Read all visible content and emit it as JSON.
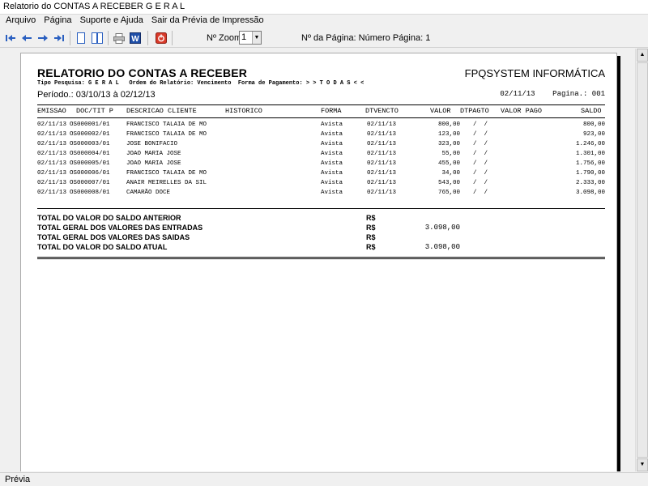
{
  "window": {
    "title": "Relatorio do CONTAS A RECEBER G E R A L"
  },
  "menu": [
    "Arquivo",
    "Página",
    "Suporte e Ajuda",
    "Sair da Prévia de Impressão"
  ],
  "toolbar": {
    "first_icon": "first-page-icon",
    "prev_icon": "prev-page-icon",
    "next_icon": "next-page-icon",
    "last_icon": "last-page-icon",
    "zoom_label": "Nº Zoom",
    "zoom_value": "1",
    "page_label": "Nº da Página: Número Página: 1"
  },
  "report": {
    "title": "RELATORIO DO CONTAS A RECEBER",
    "company": "FPQSYSTEM INFORMÁTICA",
    "subline": "Tipo Pesquisa: G E R A L   Ordem do Relatório: Vencimento  Forma de Pagamento: > > T O D A S < <",
    "periodo": "Período.: 03/10/13 à 02/12/13",
    "date_page": "02/11/13    Pagina.: 001",
    "columns": {
      "emissao": "EMISSAO",
      "doc": "DOC/TIT P",
      "descricao": "DESCRICAO CLIENTE",
      "historico": "HISTORICO",
      "forma": "FORMA",
      "dtvencto": "DTVENCTO",
      "valor": "VALOR",
      "dtpagto": "DTPAGTO",
      "valor_pago": "VALOR PAGO",
      "saldo": "SALDO"
    },
    "rows": [
      {
        "emissao": "02/11/13",
        "doc": "OS000001/01",
        "cliente": "FRANCISCO TALAIA DE MO",
        "forma": "Avista",
        "dtvencto": "02/11/13",
        "valor": "800,00",
        "dtpagto": "/  /",
        "saldo": "800,00"
      },
      {
        "emissao": "02/11/13",
        "doc": "OS000002/01",
        "cliente": "FRANCISCO TALAIA DE MO",
        "forma": "Avista",
        "dtvencto": "02/11/13",
        "valor": "123,00",
        "dtpagto": "/  /",
        "saldo": "923,00"
      },
      {
        "emissao": "02/11/13",
        "doc": "OS000003/01",
        "cliente": "JOSE BONIFACIO",
        "forma": "Avista",
        "dtvencto": "02/11/13",
        "valor": "323,00",
        "dtpagto": "/  /",
        "saldo": "1.246,00"
      },
      {
        "emissao": "02/11/13",
        "doc": "OS000004/01",
        "cliente": "JOAO MARIA JOSE",
        "forma": "Avista",
        "dtvencto": "02/11/13",
        "valor": "55,00",
        "dtpagto": "/  /",
        "saldo": "1.301,00"
      },
      {
        "emissao": "02/11/13",
        "doc": "OS000005/01",
        "cliente": "JOAO MARIA JOSE",
        "forma": "Avista",
        "dtvencto": "02/11/13",
        "valor": "455,00",
        "dtpagto": "/  /",
        "saldo": "1.756,00"
      },
      {
        "emissao": "02/11/13",
        "doc": "OS000006/01",
        "cliente": "FRANCISCO TALAIA DE MO",
        "forma": "Avista",
        "dtvencto": "02/11/13",
        "valor": "34,00",
        "dtpagto": "/  /",
        "saldo": "1.790,00"
      },
      {
        "emissao": "02/11/13",
        "doc": "OS000007/01",
        "cliente": "ANAIR MEIRELLES DA SIL",
        "forma": "Avista",
        "dtvencto": "02/11/13",
        "valor": "543,00",
        "dtpagto": "/  /",
        "saldo": "2.333,00"
      },
      {
        "emissao": "02/11/13",
        "doc": "OS000008/01",
        "cliente": "CAMARÃO DOCE",
        "forma": "Avista",
        "dtvencto": "02/11/13",
        "valor": "765,00",
        "dtpagto": "/  /",
        "saldo": "3.098,00"
      }
    ],
    "totals": [
      {
        "label": "TOTAL DO VALOR DO SALDO ANTERIOR",
        "currency": "R$",
        "value": ""
      },
      {
        "label": "TOTAL GERAL DOS VALORES DAS ENTRADAS",
        "currency": "R$",
        "value": "3.098,00"
      },
      {
        "label": "TOTAL GERAL DOS VALORES DAS SAIDAS",
        "currency": "R$",
        "value": ""
      },
      {
        "label": "TOTAL DO VALOR DO SALDO ATUAL",
        "currency": "R$",
        "value": "3.098,00"
      }
    ]
  },
  "status": {
    "text": "Prévia"
  }
}
